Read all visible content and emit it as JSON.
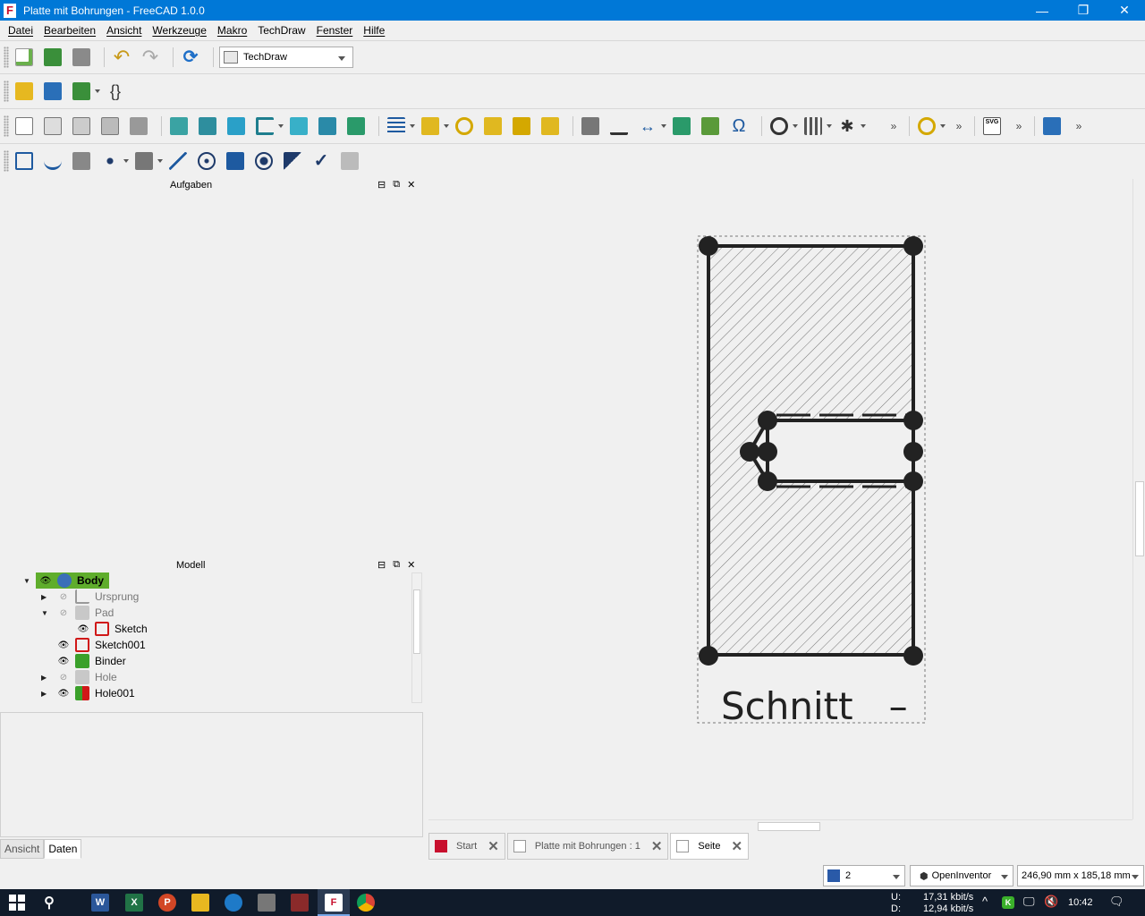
{
  "window": {
    "title": "Platte mit Bohrungen - FreeCAD 1.0.0",
    "controls": [
      "—",
      "❐",
      "✕"
    ]
  },
  "menu": [
    "Datei",
    "Bearbeiten",
    "Ansicht",
    "Werkzeuge",
    "Makro",
    "TechDraw",
    "Fenster",
    "Hilfe"
  ],
  "toolbar": {
    "workbench": "TechDraw",
    "overflow": "»"
  },
  "tasks_panel": {
    "title": "Aufgaben"
  },
  "model_panel": {
    "title": "Modell",
    "tree": [
      {
        "label": "Body",
        "visible": true
      },
      {
        "label": "Ursprung",
        "visible": false
      },
      {
        "label": "Pad",
        "visible": false
      },
      {
        "label": "Sketch",
        "visible": true
      },
      {
        "label": "Sketch001",
        "visible": true
      },
      {
        "label": "Binder",
        "visible": true
      },
      {
        "label": "Hole",
        "visible": false
      },
      {
        "label": "Hole001",
        "visible": true
      }
    ]
  },
  "property_tabs": [
    "Ansicht",
    "Daten"
  ],
  "drawing": {
    "view_label": "Schnitt   –"
  },
  "doc_tabs": [
    "Start",
    "Platte mit Bohrungen : 1",
    "Seite"
  ],
  "status": {
    "combo1": "2",
    "navigation": "OpenInventor",
    "dimensions": "246,90 mm x 185,18 mm"
  },
  "taskbar": {
    "upload_label": "U:",
    "download_label": "D:",
    "upload": "17,31 kbit/s",
    "download": "12,94 kbit/s",
    "time": "10:42"
  },
  "colors": {
    "titlebar": "#0078d7",
    "body_highlight": "#5fad2c",
    "taskbar": "#101b2a"
  }
}
